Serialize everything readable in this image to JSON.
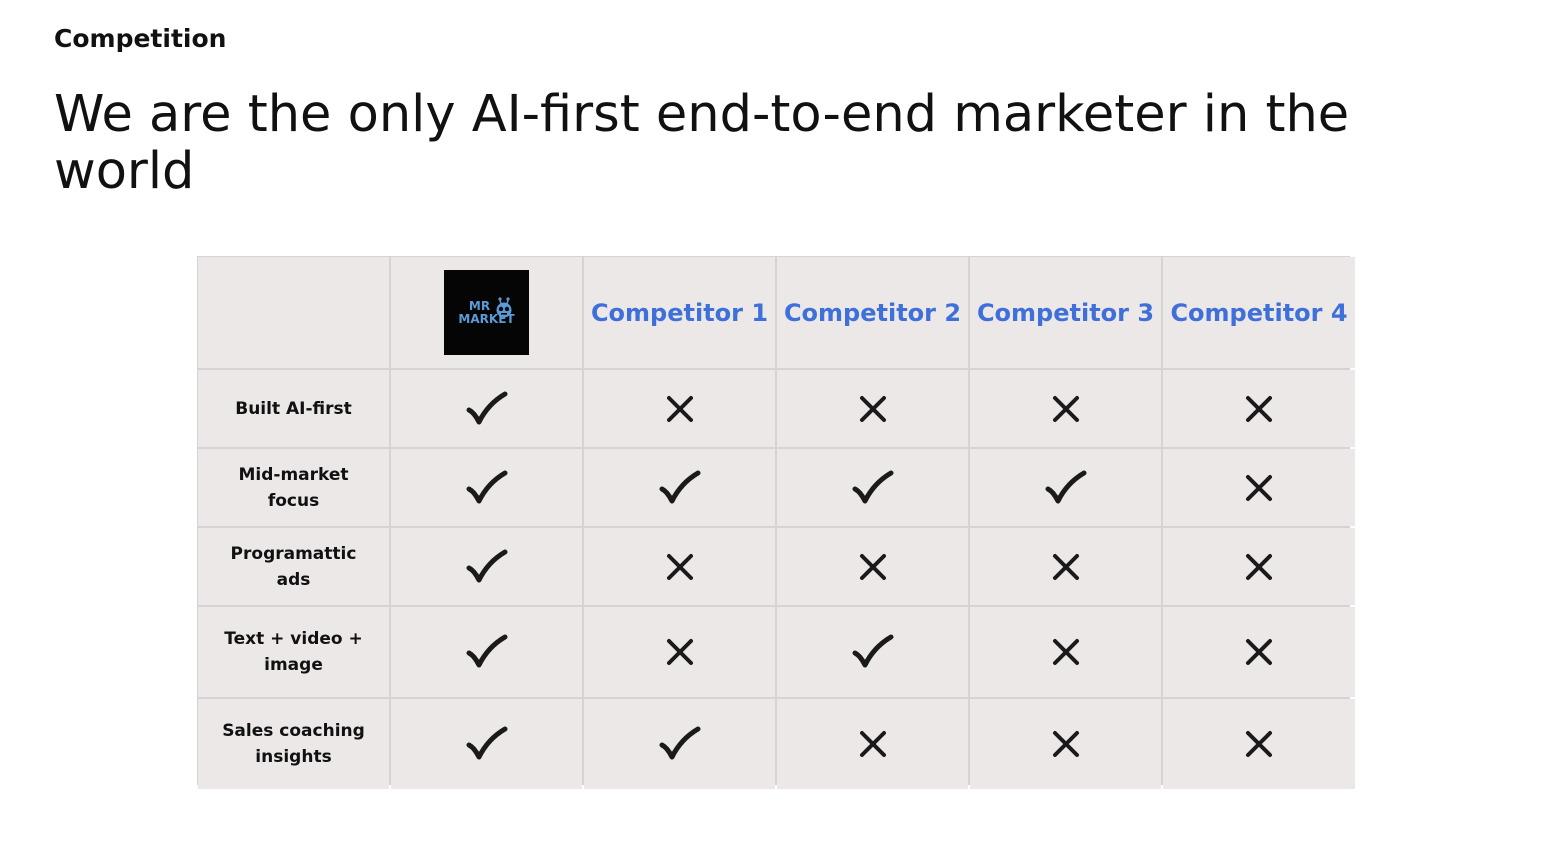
{
  "slide": {
    "eyebrow": "Competition",
    "headline": "We are the only AI-first end-to-end marketer in the world"
  },
  "table": {
    "logo": {
      "line1": "MR",
      "line2": "MARKET",
      "icon": "robot-face-icon"
    },
    "competitors": [
      "Competitor 1",
      "Competitor 2",
      "Competitor 3",
      "Competitor 4"
    ],
    "rows": [
      {
        "label": "Built AI-first",
        "marks": [
          "check",
          "cross",
          "cross",
          "cross",
          "cross"
        ]
      },
      {
        "label": "Mid-market focus",
        "marks": [
          "check",
          "check",
          "check",
          "check",
          "cross"
        ]
      },
      {
        "label": "Programattic ads",
        "marks": [
          "check",
          "cross",
          "cross",
          "cross",
          "cross"
        ]
      },
      {
        "label": "Text + video + image",
        "marks": [
          "check",
          "cross",
          "check",
          "cross",
          "cross"
        ]
      },
      {
        "label": "Sales coaching insights",
        "marks": [
          "check",
          "check",
          "cross",
          "cross",
          "cross"
        ]
      }
    ],
    "colors": {
      "competitor_text": "#3f6fd8",
      "cell_bg": "#ebe8e7",
      "grid_line": "#d5d3d3",
      "mark": "#1a1a1a"
    }
  }
}
